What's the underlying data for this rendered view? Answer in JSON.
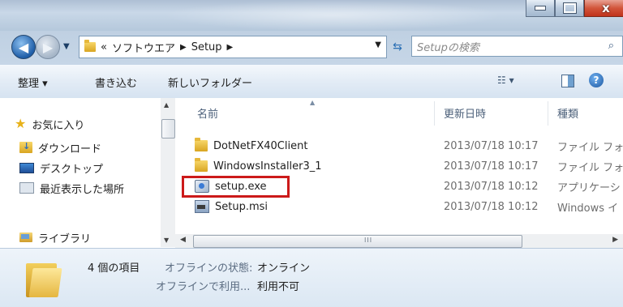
{
  "window": {
    "controls": {
      "minimize": "_",
      "maximize": "□",
      "close": "x"
    }
  },
  "address": {
    "overflow": "«",
    "breadcrumbs": [
      "ソフトウエア",
      "Setup"
    ],
    "search_placeholder": "Setupの検索"
  },
  "toolbar": {
    "organize": "整理 ▾",
    "burn": "書き込む",
    "new_folder": "新しいフォルダー",
    "view": "☷ ▾",
    "help": "?"
  },
  "nav": {
    "favorites": "お気に入り",
    "downloads": "ダウンロード",
    "desktop": "デスクトップ",
    "recent": "最近表示した場所",
    "libraries": "ライブラリ"
  },
  "columns": {
    "name": "名前",
    "date": "更新日時",
    "type": "種類"
  },
  "files": [
    {
      "name": "DotNetFX40Client",
      "date": "2013/07/18 10:17",
      "type": "ファイル フォ",
      "icon": "folder-icon"
    },
    {
      "name": "WindowsInstaller3_1",
      "date": "2013/07/18 10:17",
      "type": "ファイル フォ",
      "icon": "folder-icon"
    },
    {
      "name": "setup.exe",
      "date": "2013/07/18 10:12",
      "type": "アプリケーシ",
      "icon": "exe-icon",
      "highlighted": true
    },
    {
      "name": "Setup.msi",
      "date": "2013/07/18 10:12",
      "type": "Windows イ",
      "icon": "msi-icon"
    }
  ],
  "details": {
    "count": "4 個の項目",
    "offline_status_label": "オフラインの状態:",
    "offline_status_value": "オンライン",
    "offline_avail_label": "オフラインで利用...",
    "offline_avail_value": "利用不可"
  },
  "colors": {
    "highlight_border": "#cc1a1a",
    "aero_title": "#b5c8dc",
    "toolbar": "#e3ecf6"
  }
}
